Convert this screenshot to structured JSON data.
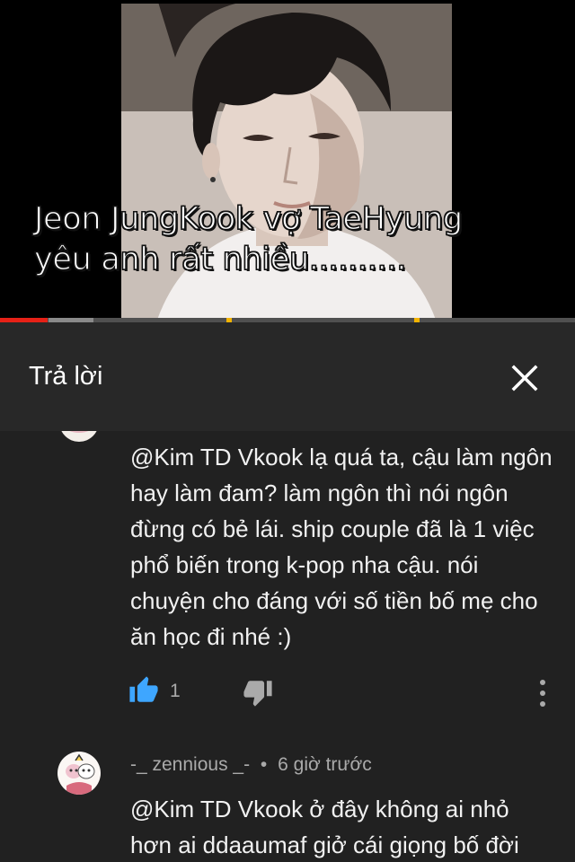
{
  "video": {
    "caption_line1": "Jeon JungKook vợ TaeHyung",
    "caption_line2": "yêu anh rất nhiều..........",
    "progress": {
      "played_fraction": 0.083,
      "buffered_to_fraction": 0.163
    }
  },
  "header": {
    "title": "Trả lời",
    "close_icon": "close-icon"
  },
  "comments": [
    {
      "author": "",
      "time": "",
      "text": "@Kim TD Vkook lạ quá ta, cậu làm ngôn hay làm đam? làm ngôn thì nói ngôn đừng có bẻ lái. ship couple đã là 1 việc phổ biến trong k-pop nha cậu. nói chuyện cho đáng với số tiền bố mẹ cho ăn học đi nhé :)",
      "likes": "1",
      "like_icon": "thumbs-up-icon",
      "dislike_icon": "thumbs-down-icon",
      "more_icon": "more-vert-icon"
    },
    {
      "author": "-_ zennious _-",
      "separator": "•",
      "time": "6 giờ trước",
      "text": "@Kim TD Vkook ở đây không ai nhỏ hơn ai ddaaumaf giở cái giọng bố đời"
    }
  ],
  "colors": {
    "background": "#212121",
    "header_bg": "#282828",
    "like_active": "#3ea6ff",
    "progress_red": "#e62117",
    "ad_marker": "#f4b400"
  }
}
